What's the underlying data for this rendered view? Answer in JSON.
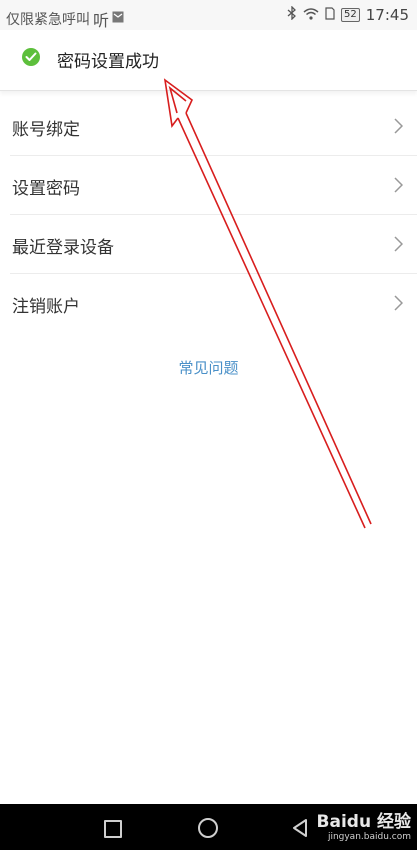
{
  "status_bar": {
    "left_text": "仅限紧急呼叫",
    "listen_text": "听",
    "time": "17:45",
    "battery": "52"
  },
  "toast": {
    "message": "密码设置成功",
    "icon": "check-circle-icon",
    "icon_color": "#5dbf3c"
  },
  "settings": {
    "items": [
      {
        "label": "账号绑定",
        "icon": "chevron-right-icon"
      },
      {
        "label": "设置密码",
        "icon": "chevron-right-icon"
      },
      {
        "label": "最近登录设备",
        "icon": "chevron-right-icon"
      },
      {
        "label": "注销账户",
        "icon": "chevron-right-icon"
      }
    ],
    "faq_label": "常见问题",
    "link_color": "#4a90c8"
  },
  "annotation": {
    "arrow_color": "#d81e1e"
  },
  "watermark": {
    "brand": "Baidu 经验",
    "url": "jingyan.baidu.com"
  }
}
